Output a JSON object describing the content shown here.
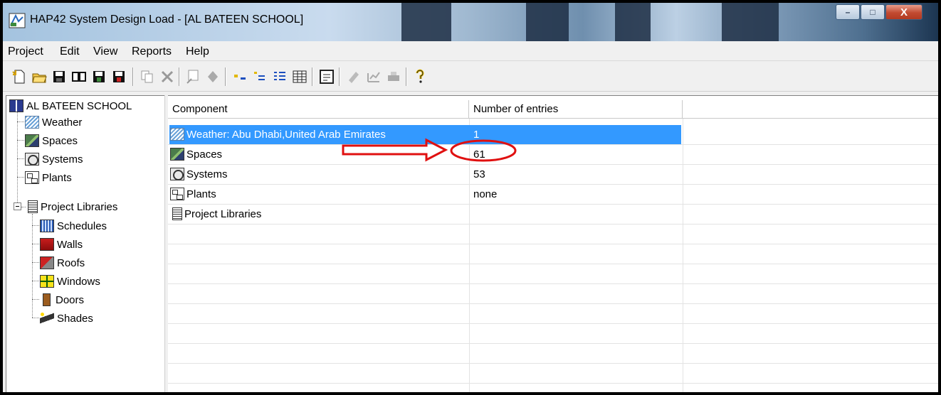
{
  "window": {
    "title": "HAP42 System Design Load - [AL BATEEN SCHOOL]",
    "buttons": {
      "minimize": "–",
      "maximize": "□",
      "close": "X"
    }
  },
  "menu": [
    "Project",
    "Edit",
    "View",
    "Reports",
    "Help"
  ],
  "toolbar": {
    "buttons": [
      "new-file-icon",
      "open-folder-icon",
      "save-icon",
      "library-icon",
      "save-as-icon",
      "save-archive-icon",
      "copy-icon",
      "delete-icon",
      "properties-icon",
      "diamond-icon",
      "sort-icon",
      "filter-icon",
      "list-view-icon",
      "details-view-icon",
      "calculator-icon",
      "report-icon",
      "chart-icon",
      "print-icon",
      "help-icon"
    ]
  },
  "tree": {
    "root": "AL BATEEN SCHOOL",
    "items": [
      {
        "label": "Weather",
        "icon": "weather-icon"
      },
      {
        "label": "Spaces",
        "icon": "spaces-icon"
      },
      {
        "label": "Systems",
        "icon": "systems-icon"
      },
      {
        "label": "Plants",
        "icon": "plants-icon"
      },
      {
        "label": "Project Libraries",
        "icon": "project-libraries-icon",
        "expanded": true
      }
    ],
    "libraries": [
      {
        "label": "Schedules",
        "icon": "schedules-icon"
      },
      {
        "label": "Walls",
        "icon": "walls-icon"
      },
      {
        "label": "Roofs",
        "icon": "roofs-icon"
      },
      {
        "label": "Windows",
        "icon": "windows-icon"
      },
      {
        "label": "Doors",
        "icon": "doors-icon"
      },
      {
        "label": "Shades",
        "icon": "shades-icon"
      }
    ]
  },
  "list": {
    "columns": [
      "Component",
      "Number of entries"
    ],
    "rows": [
      {
        "component": "Weather: Abu Dhabi,United Arab Emirates",
        "entries": "1",
        "selected": true,
        "icon": "weather-icon"
      },
      {
        "component": "Spaces",
        "entries": "61",
        "highlighted": true,
        "icon": "spaces-icon"
      },
      {
        "component": "Systems",
        "entries": "53",
        "icon": "systems-icon"
      },
      {
        "component": "Plants",
        "entries": "none",
        "icon": "plants-icon"
      },
      {
        "component": "Project Libraries",
        "entries": "",
        "icon": "project-libraries-icon"
      }
    ]
  },
  "colors": {
    "selection": "#3399ff",
    "annotation": "#e01010"
  }
}
